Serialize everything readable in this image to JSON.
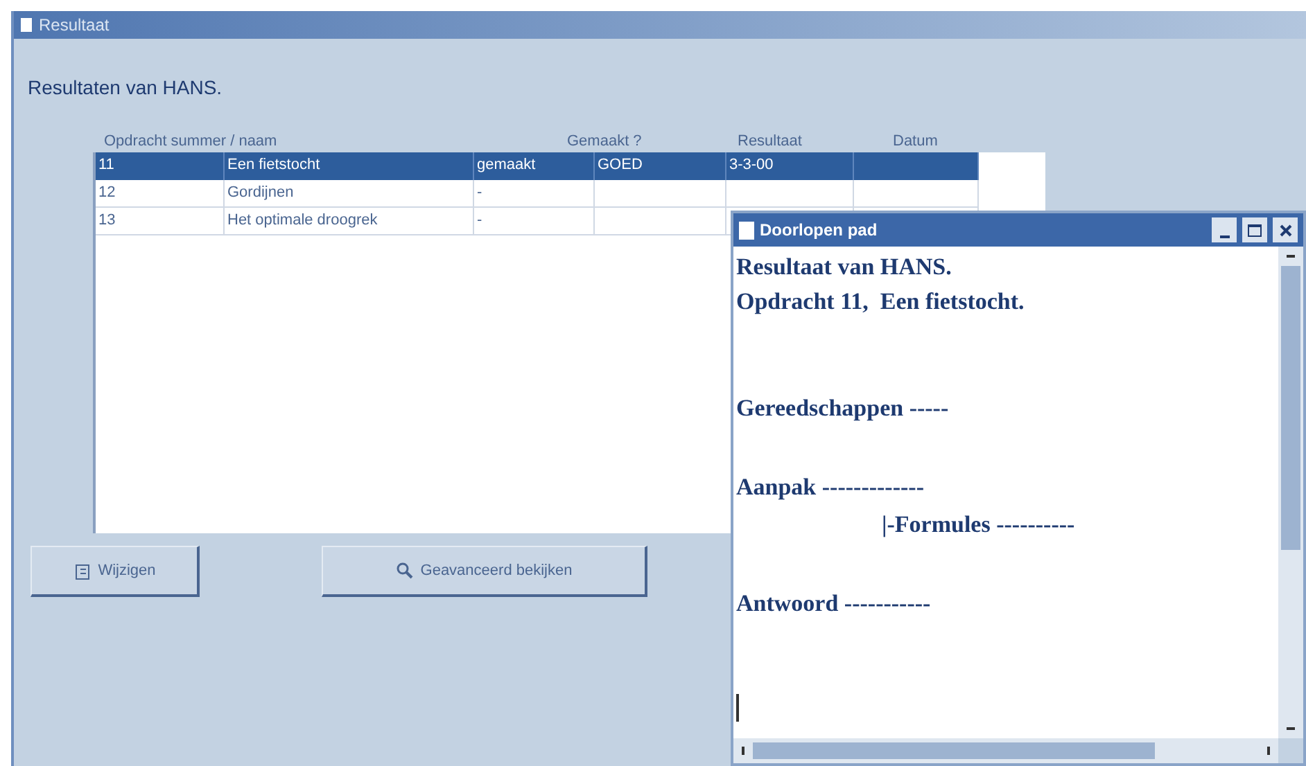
{
  "window": {
    "title": "Resultaat"
  },
  "heading": "Resultaten van HANS.",
  "table": {
    "columns": [
      "Opdracht summer / naam",
      "",
      "",
      "Gemaakt ?",
      "Resultaat",
      "Datum"
    ],
    "rows": [
      {
        "selected": true,
        "cells": [
          "11",
          "Een fietstocht",
          "gemaakt",
          "GOED",
          "3-3-00",
          ""
        ]
      },
      {
        "selected": false,
        "cells": [
          "12",
          "Gordijnen",
          "-",
          "",
          "",
          ""
        ]
      },
      {
        "selected": false,
        "cells": [
          "13",
          "Het optimale droogrek",
          "-",
          "",
          "",
          ""
        ]
      }
    ]
  },
  "buttons": [
    {
      "kind": "edit",
      "label": "Wijzigen"
    },
    {
      "kind": "search",
      "label": "Geavanceerd bekijken"
    }
  ],
  "child_window": {
    "title": "Doorlopen pad",
    "lines": [
      {
        "kind": "title",
        "text": "Resultaat van HANS."
      },
      {
        "kind": "title",
        "text": "Opdracht 11,  Een fietstocht."
      },
      {
        "kind": "section",
        "text": "Gereedschappen -----"
      },
      {
        "kind": "section",
        "text": "Aanpak -------------"
      },
      {
        "kind": "subsection",
        "text": "|-Formules ----------"
      },
      {
        "kind": "section",
        "text": "Antwoord -----------"
      }
    ]
  }
}
